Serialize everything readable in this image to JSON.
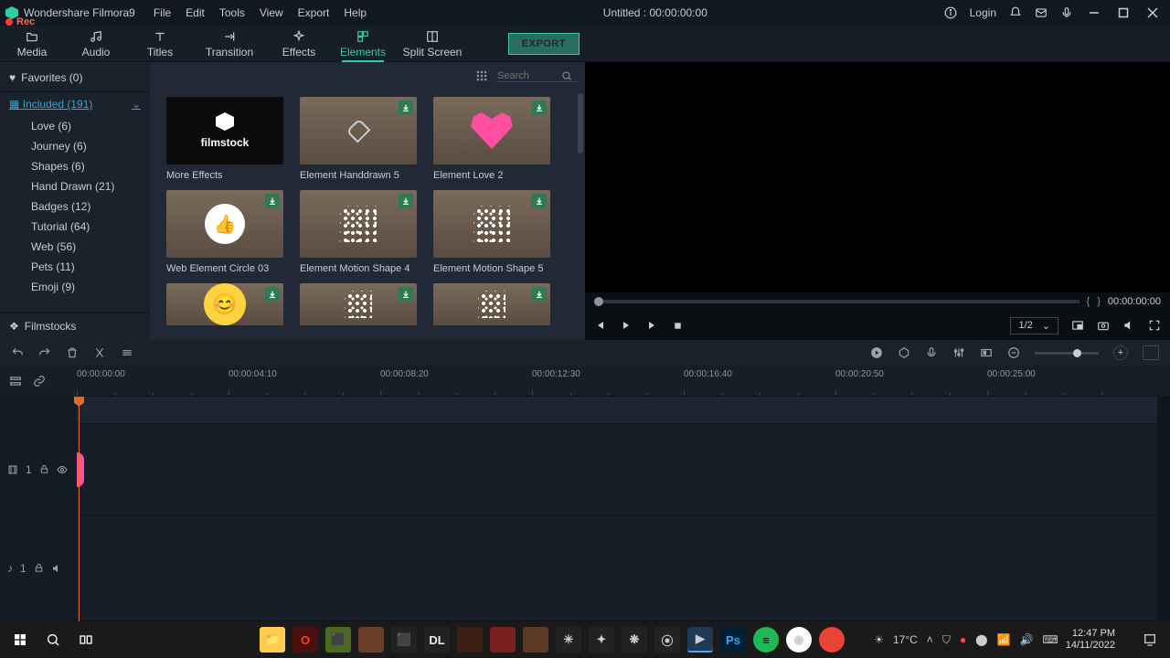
{
  "app": {
    "title": "Wondershare Filmora9",
    "rec": "Rec"
  },
  "menu": {
    "file": "File",
    "edit": "Edit",
    "tools": "Tools",
    "view": "View",
    "export": "Export",
    "help": "Help"
  },
  "doc_title": "Untitled : 00:00:00:00",
  "titlebar": {
    "login": "Login"
  },
  "tabs": {
    "media": "Media",
    "audio": "Audio",
    "titles": "Titles",
    "transition": "Transition",
    "effects": "Effects",
    "elements": "Elements",
    "split": "Split Screen",
    "export": "EXPORT"
  },
  "sidebar": {
    "favorites": "Favorites (0)",
    "included": "Included (191)",
    "subs": [
      "Love (6)",
      "Journey (6)",
      "Shapes (6)",
      "Hand Drawn (21)",
      "Badges (12)",
      "Tutorial (64)",
      "Web (56)",
      "Pets (11)",
      "Emoji (9)"
    ],
    "filmstocks": "Filmstocks"
  },
  "search": {
    "placeholder": "Search"
  },
  "cards": {
    "more": "More Effects",
    "hand5": "Element Handdrawn 5",
    "love2": "Element Love 2",
    "webcircle": "Web Element Circle 03",
    "motion4": "Element Motion Shape 4",
    "motion5": "Element Motion Shape 5"
  },
  "filmstock_brand": "filmstock",
  "preview": {
    "time": "00:00:00:00",
    "ratio": "1/2"
  },
  "ruler": [
    "00:00:00:00",
    "00:00:04:10",
    "00:00:08:20",
    "00:00:12:30",
    "00:00:16:40",
    "00:00:20:50",
    "00:00:25:00"
  ],
  "tracks": {
    "video": "1",
    "audio": "1"
  },
  "taskbar": {
    "temp": "17°C",
    "time": "12:47 PM",
    "date": "14/11/2022"
  }
}
